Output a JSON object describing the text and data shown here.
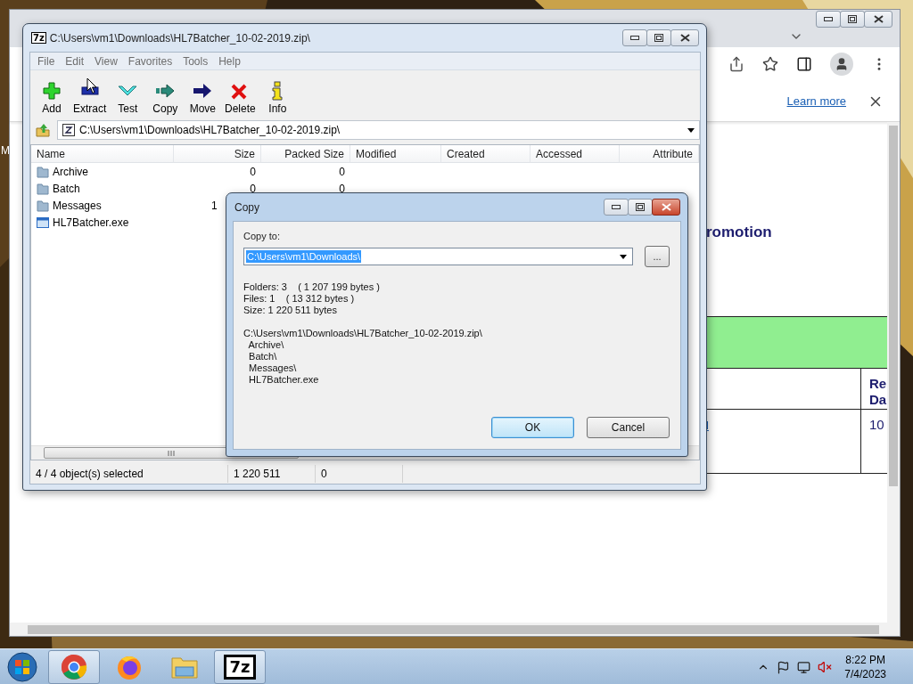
{
  "desktop": {
    "icon_label": "M"
  },
  "browser": {
    "info_bar": {
      "link": "Learn more"
    },
    "page": {
      "heading": "romotion",
      "table": {
        "header": {
          "column_2": [
            "Re",
            "Da"
          ]
        },
        "row": {
          "column_1": "l",
          "column_2": "10"
        }
      }
    }
  },
  "sevenzip": {
    "logo": "7z",
    "title": "C:\\Users\\vm1\\Downloads\\HL7Batcher_10-02-2019.zip\\",
    "menu": [
      "File",
      "Edit",
      "View",
      "Favorites",
      "Tools",
      "Help"
    ],
    "toolbar": [
      {
        "label": "Add",
        "kind": "add"
      },
      {
        "label": "Extract",
        "kind": "extract"
      },
      {
        "label": "Test",
        "kind": "test"
      },
      {
        "label": "Copy",
        "kind": "copy"
      },
      {
        "label": "Move",
        "kind": "move"
      },
      {
        "label": "Delete",
        "kind": "delete"
      },
      {
        "label": "Info",
        "kind": "info"
      }
    ],
    "address": "C:\\Users\\vm1\\Downloads\\HL7Batcher_10-02-2019.zip\\",
    "columns": [
      "Name",
      "Size",
      "Packed Size",
      "Modified",
      "Created",
      "Accessed",
      "Attribute"
    ],
    "rows": [
      {
        "name": "Archive",
        "kind": "folder",
        "size": "0",
        "packed_size": "0"
      },
      {
        "name": "Batch",
        "kind": "folder",
        "size": "0",
        "packed_size": "0"
      },
      {
        "name": "Messages",
        "kind": "folder",
        "size": "1",
        "size_cut": true
      },
      {
        "name": "HL7Batcher.exe",
        "kind": "file"
      }
    ],
    "status": [
      "4 / 4 object(s) selected",
      "1 220 511",
      "0"
    ]
  },
  "dialog": {
    "title": "Copy",
    "label": "Copy to:",
    "path": {
      "value": "C:\\Users\\vm1\\Downloads\\",
      "selected": true
    },
    "browse": "...",
    "details": [
      "Folders: 3    ( 1 207 199 bytes )",
      "Files: 1    ( 13 312 bytes )",
      "Size: 1 220 511 bytes"
    ],
    "listing": [
      "C:\\Users\\vm1\\Downloads\\HL7Batcher_10-02-2019.zip\\",
      "  Archive\\",
      "  Batch\\",
      "  Messages\\",
      "  HL7Batcher.exe"
    ],
    "buttons": [
      {
        "label": "OK",
        "default": true
      },
      {
        "label": "Cancel",
        "default": false
      }
    ]
  },
  "taskbar": {
    "apps": [
      {
        "kind": "chrome",
        "active": true
      },
      {
        "kind": "firefox",
        "active": false
      },
      {
        "kind": "explorer",
        "active": false
      },
      {
        "kind": "sevenzip",
        "active": true,
        "label": "7z"
      }
    ],
    "clock": {
      "time": "8:22 PM",
      "date": "7/4/2023"
    }
  }
}
